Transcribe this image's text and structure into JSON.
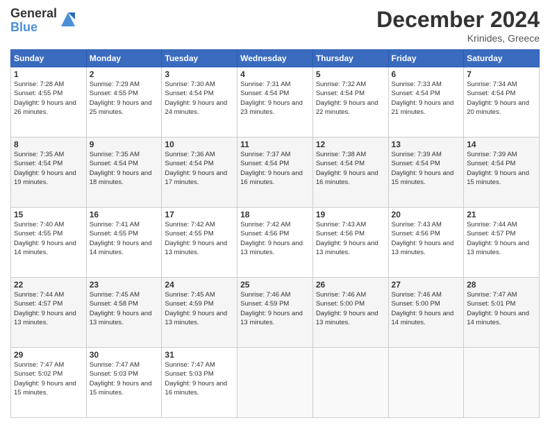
{
  "header": {
    "logo_general": "General",
    "logo_blue": "Blue",
    "month_title": "December 2024",
    "location": "Krinides, Greece"
  },
  "calendar": {
    "days_of_week": [
      "Sunday",
      "Monday",
      "Tuesday",
      "Wednesday",
      "Thursday",
      "Friday",
      "Saturday"
    ],
    "weeks": [
      [
        {
          "day": "1",
          "sunrise": "7:28 AM",
          "sunset": "4:55 PM",
          "daylight": "9 hours and 26 minutes."
        },
        {
          "day": "2",
          "sunrise": "7:29 AM",
          "sunset": "4:55 PM",
          "daylight": "9 hours and 25 minutes."
        },
        {
          "day": "3",
          "sunrise": "7:30 AM",
          "sunset": "4:54 PM",
          "daylight": "9 hours and 24 minutes."
        },
        {
          "day": "4",
          "sunrise": "7:31 AM",
          "sunset": "4:54 PM",
          "daylight": "9 hours and 23 minutes."
        },
        {
          "day": "5",
          "sunrise": "7:32 AM",
          "sunset": "4:54 PM",
          "daylight": "9 hours and 22 minutes."
        },
        {
          "day": "6",
          "sunrise": "7:33 AM",
          "sunset": "4:54 PM",
          "daylight": "9 hours and 21 minutes."
        },
        {
          "day": "7",
          "sunrise": "7:34 AM",
          "sunset": "4:54 PM",
          "daylight": "9 hours and 20 minutes."
        }
      ],
      [
        {
          "day": "8",
          "sunrise": "7:35 AM",
          "sunset": "4:54 PM",
          "daylight": "9 hours and 19 minutes."
        },
        {
          "day": "9",
          "sunrise": "7:35 AM",
          "sunset": "4:54 PM",
          "daylight": "9 hours and 18 minutes."
        },
        {
          "day": "10",
          "sunrise": "7:36 AM",
          "sunset": "4:54 PM",
          "daylight": "9 hours and 17 minutes."
        },
        {
          "day": "11",
          "sunrise": "7:37 AM",
          "sunset": "4:54 PM",
          "daylight": "9 hours and 16 minutes."
        },
        {
          "day": "12",
          "sunrise": "7:38 AM",
          "sunset": "4:54 PM",
          "daylight": "9 hours and 16 minutes."
        },
        {
          "day": "13",
          "sunrise": "7:39 AM",
          "sunset": "4:54 PM",
          "daylight": "9 hours and 15 minutes."
        },
        {
          "day": "14",
          "sunrise": "7:39 AM",
          "sunset": "4:54 PM",
          "daylight": "9 hours and 15 minutes."
        }
      ],
      [
        {
          "day": "15",
          "sunrise": "7:40 AM",
          "sunset": "4:55 PM",
          "daylight": "9 hours and 14 minutes."
        },
        {
          "day": "16",
          "sunrise": "7:41 AM",
          "sunset": "4:55 PM",
          "daylight": "9 hours and 14 minutes."
        },
        {
          "day": "17",
          "sunrise": "7:42 AM",
          "sunset": "4:55 PM",
          "daylight": "9 hours and 13 minutes."
        },
        {
          "day": "18",
          "sunrise": "7:42 AM",
          "sunset": "4:56 PM",
          "daylight": "9 hours and 13 minutes."
        },
        {
          "day": "19",
          "sunrise": "7:43 AM",
          "sunset": "4:56 PM",
          "daylight": "9 hours and 13 minutes."
        },
        {
          "day": "20",
          "sunrise": "7:43 AM",
          "sunset": "4:56 PM",
          "daylight": "9 hours and 13 minutes."
        },
        {
          "day": "21",
          "sunrise": "7:44 AM",
          "sunset": "4:57 PM",
          "daylight": "9 hours and 13 minutes."
        }
      ],
      [
        {
          "day": "22",
          "sunrise": "7:44 AM",
          "sunset": "4:57 PM",
          "daylight": "9 hours and 13 minutes."
        },
        {
          "day": "23",
          "sunrise": "7:45 AM",
          "sunset": "4:58 PM",
          "daylight": "9 hours and 13 minutes."
        },
        {
          "day": "24",
          "sunrise": "7:45 AM",
          "sunset": "4:59 PM",
          "daylight": "9 hours and 13 minutes."
        },
        {
          "day": "25",
          "sunrise": "7:46 AM",
          "sunset": "4:59 PM",
          "daylight": "9 hours and 13 minutes."
        },
        {
          "day": "26",
          "sunrise": "7:46 AM",
          "sunset": "5:00 PM",
          "daylight": "9 hours and 13 minutes."
        },
        {
          "day": "27",
          "sunrise": "7:46 AM",
          "sunset": "5:00 PM",
          "daylight": "9 hours and 14 minutes."
        },
        {
          "day": "28",
          "sunrise": "7:47 AM",
          "sunset": "5:01 PM",
          "daylight": "9 hours and 14 minutes."
        }
      ],
      [
        {
          "day": "29",
          "sunrise": "7:47 AM",
          "sunset": "5:02 PM",
          "daylight": "9 hours and 15 minutes."
        },
        {
          "day": "30",
          "sunrise": "7:47 AM",
          "sunset": "5:03 PM",
          "daylight": "9 hours and 15 minutes."
        },
        {
          "day": "31",
          "sunrise": "7:47 AM",
          "sunset": "5:03 PM",
          "daylight": "9 hours and 16 minutes."
        },
        null,
        null,
        null,
        null
      ]
    ]
  }
}
